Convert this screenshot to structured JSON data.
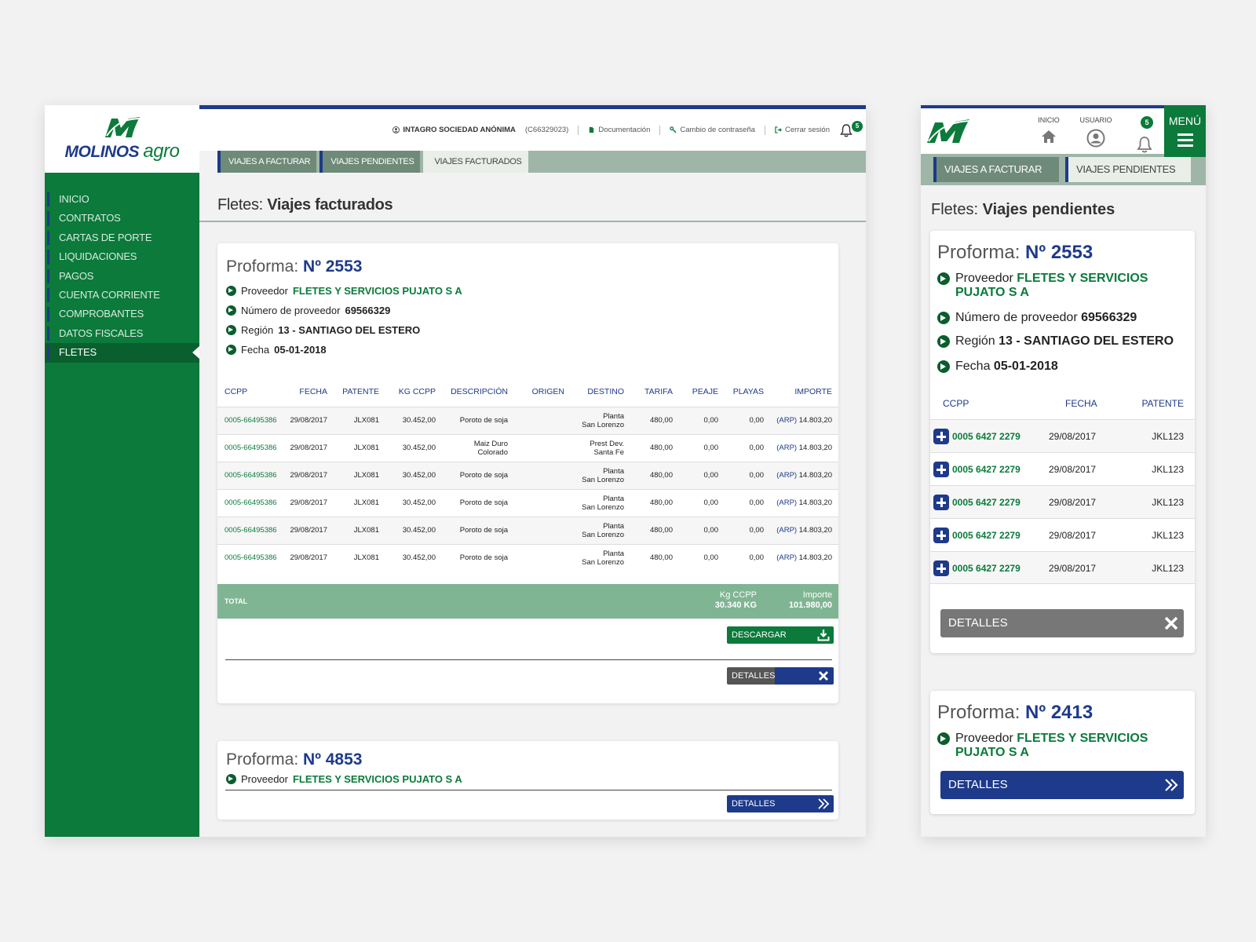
{
  "brand": {
    "logo_word1": "MOLINOS",
    "logo_word2": "agro"
  },
  "colors": {
    "green": "#0b7a3b",
    "navy": "#1e3a8a",
    "sage": "#9fb5a8",
    "total_green": "#7fb593"
  },
  "desktop": {
    "sidebar": {
      "items": [
        {
          "label": "INICIO"
        },
        {
          "label": "CONTRATOS"
        },
        {
          "label": "CARTAS DE PORTE"
        },
        {
          "label": "LIQUIDACIONES"
        },
        {
          "label": "PAGOS"
        },
        {
          "label": "CUENTA CORRIENTE"
        },
        {
          "label": "COMPROBANTES"
        },
        {
          "label": "DATOS FISCALES"
        },
        {
          "label": "FLETES",
          "active": true
        }
      ]
    },
    "topbar": {
      "company": "INTAGRO SOCIEDAD ANÓNIMA",
      "code": "(C66329023)",
      "documentacion": "Documentación",
      "cambio": "Cambio de contraseña",
      "cerrar": "Cerrar sesión",
      "notifications": "5"
    },
    "tabs": [
      "VIAJES A FACTURAR",
      "VIAJES PENDIENTES",
      "VIAJES FACTURADOS"
    ],
    "active_tab": "VIAJES FACTURADOS",
    "title_prefix": "Fletes:",
    "title": "Viajes facturados",
    "card1": {
      "proforma_label": "Proforma:",
      "proforma_no": "Nº 2553",
      "proveedor_label": "Proveedor",
      "proveedor": "FLETES Y SERVICIOS PUJATO S A",
      "numero_label": "Número de proveedor",
      "numero": "69566329",
      "region_label": "Región",
      "region": "13 - SANTIAGO DEL ESTERO",
      "fecha_label": "Fecha",
      "fecha": "05-01-2018",
      "columns": [
        "CCPP",
        "FECHA",
        "PATENTE",
        "KG CCPP",
        "DESCRIPCIÓN",
        "ORIGEN",
        "DESTINO",
        "TARIFA",
        "PEAJE",
        "PLAYAS",
        "IMPORTE"
      ],
      "rows": [
        {
          "ccpp": "0005-66495386",
          "fecha": "29/08/2017",
          "patente": "JLX081",
          "kg": "30.452,00",
          "desc1": "Poroto de soja",
          "desc2": "",
          "origen": "",
          "dest1": "Planta",
          "dest2": "San Lorenzo",
          "tarifa": "480,00",
          "peaje": "0,00",
          "playas": "0,00",
          "currency": "(ARP)",
          "importe": "14.803,20"
        },
        {
          "ccpp": "0005-66495386",
          "fecha": "29/08/2017",
          "patente": "JLX081",
          "kg": "30.452,00",
          "desc1": "Maiz Duro",
          "desc2": "Colorado",
          "origen": "",
          "dest1": "Prest Dev.",
          "dest2": "Santa Fe",
          "tarifa": "480,00",
          "peaje": "0,00",
          "playas": "0,00",
          "currency": "(ARP)",
          "importe": "14.803,20"
        },
        {
          "ccpp": "0005-66495386",
          "fecha": "29/08/2017",
          "patente": "JLX081",
          "kg": "30.452,00",
          "desc1": "Poroto de soja",
          "desc2": "",
          "origen": "",
          "dest1": "Planta",
          "dest2": "San Lorenzo",
          "tarifa": "480,00",
          "peaje": "0,00",
          "playas": "0,00",
          "currency": "(ARP)",
          "importe": "14.803,20"
        },
        {
          "ccpp": "0005-66495386",
          "fecha": "29/08/2017",
          "patente": "JLX081",
          "kg": "30.452,00",
          "desc1": "Poroto de soja",
          "desc2": "",
          "origen": "",
          "dest1": "Planta",
          "dest2": "San Lorenzo",
          "tarifa": "480,00",
          "peaje": "0,00",
          "playas": "0,00",
          "currency": "(ARP)",
          "importe": "14.803,20"
        },
        {
          "ccpp": "0005-66495386",
          "fecha": "29/08/2017",
          "patente": "JLX081",
          "kg": "30.452,00",
          "desc1": "Poroto de soja",
          "desc2": "",
          "origen": "",
          "dest1": "Planta",
          "dest2": "San Lorenzo",
          "tarifa": "480,00",
          "peaje": "0,00",
          "playas": "0,00",
          "currency": "(ARP)",
          "importe": "14.803,20"
        },
        {
          "ccpp": "0005-66495386",
          "fecha": "29/08/2017",
          "patente": "JLX081",
          "kg": "30.452,00",
          "desc1": "Poroto de soja",
          "desc2": "",
          "origen": "",
          "dest1": "Planta",
          "dest2": "San Lorenzo",
          "tarifa": "480,00",
          "peaje": "0,00",
          "playas": "0,00",
          "currency": "(ARP)",
          "importe": "14.803,20"
        }
      ],
      "total_label": "TOTAL",
      "total_kg_label": "Kg CCPP",
      "total_kg": "30.340 KG",
      "total_importe_label": "Importe",
      "total_importe": "101.980,00",
      "descargar": "DESCARGAR",
      "detalles": "DETALLES"
    },
    "card2": {
      "proforma_label": "Proforma:",
      "proforma_no": "Nº 4853",
      "proveedor_label": "Proveedor",
      "proveedor": "FLETES Y SERVICIOS PUJATO S A",
      "detalles": "DETALLES"
    }
  },
  "mobile": {
    "nav": {
      "inicio": "INICIO",
      "usuario": "USUARIO",
      "notifications": "5",
      "menu": "MENÚ"
    },
    "tabs": [
      "VIAJES A FACTURAR",
      "VIAJES PENDIENTES"
    ],
    "title_prefix": "Fletes:",
    "title": "Viajes pendientes",
    "card1": {
      "proforma_label": "Proforma:",
      "proforma_no": "Nº 2553",
      "proveedor_label": "Proveedor",
      "proveedor_l1": "FLETES Y SERVICIOS",
      "proveedor_l2": "PUJATO S A",
      "numero_label": "Número de proveedor",
      "numero": "69566329",
      "region_label": "Región",
      "region": "13 - SANTIAGO DEL ESTERO",
      "fecha_label": "Fecha",
      "fecha": "05-01-2018",
      "columns": [
        "CCPP",
        "FECHA",
        "PATENTE"
      ],
      "rows": [
        {
          "ccpp": "0005 6427 2279",
          "fecha": "29/08/2017",
          "patente": "JKL123"
        },
        {
          "ccpp": "0005 6427 2279",
          "fecha": "29/08/2017",
          "patente": "JKL123"
        },
        {
          "ccpp": "0005 6427 2279",
          "fecha": "29/08/2017",
          "patente": "JKL123"
        },
        {
          "ccpp": "0005 6427 2279",
          "fecha": "29/08/2017",
          "patente": "JKL123"
        },
        {
          "ccpp": "0005 6427 2279",
          "fecha": "29/08/2017",
          "patente": "JKL123"
        }
      ],
      "detalles": "DETALLES"
    },
    "card2": {
      "proforma_label": "Proforma:",
      "proforma_no": "Nº 2413",
      "proveedor_label": "Proveedor",
      "proveedor_l1": "FLETES Y SERVICIOS",
      "proveedor_l2": "PUJATO S A",
      "detalles": "DETALLES"
    }
  }
}
